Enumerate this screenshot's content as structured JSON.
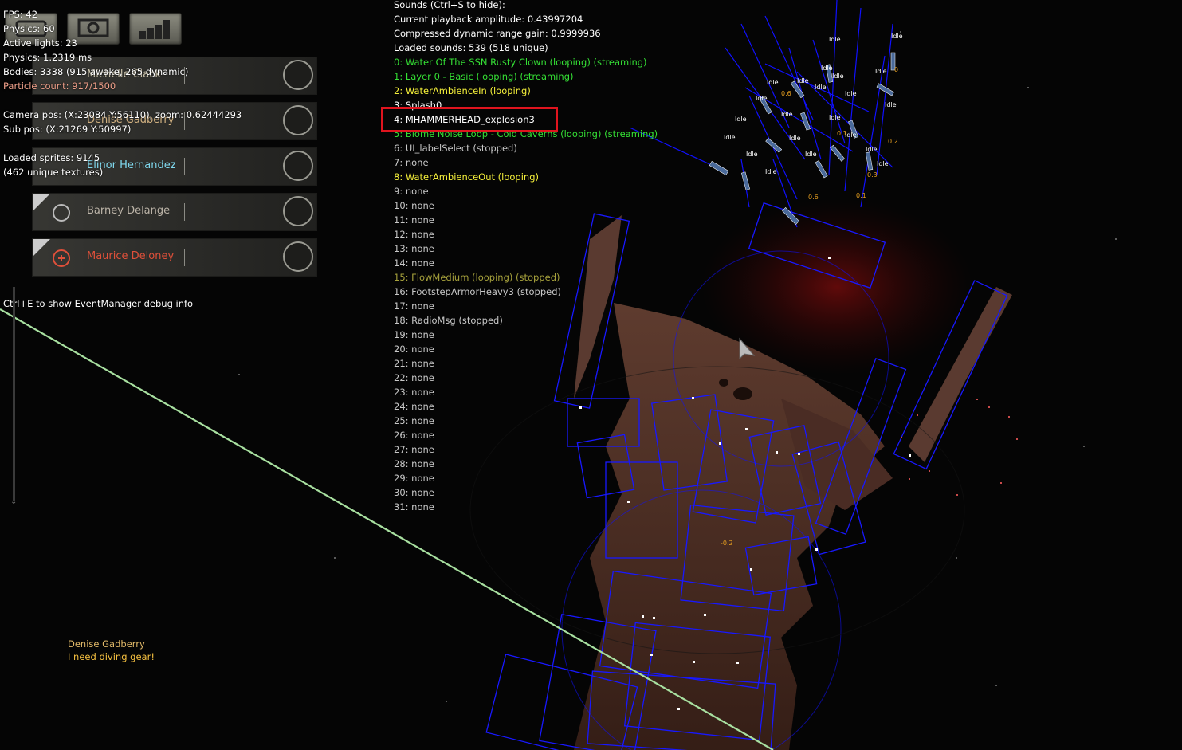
{
  "debug": {
    "fps": "FPS: 42",
    "physics": "Physics: 60",
    "active_lights": "Active lights: 23",
    "physics_time": "Physics: 1.2319 ms",
    "bodies": "Bodies: 3338 (915 awake, 265 dynamic)",
    "particle_count": "Particle count: 917/1500",
    "camera_pos": "Camera pos: (X:23084 Y:56110), zoom: 0.62444293",
    "sub_pos": "Sub pos: (X:21269 Y:50997)",
    "loaded_sprites": "Loaded sprites: 9145",
    "unique_textures": "(462 unique textures)"
  },
  "toolbar": {
    "icons": [
      "crew-icon",
      "command-icon",
      "stats-icon"
    ]
  },
  "crew": [
    {
      "name": "Michelle Clack",
      "color": "#d0c8b0",
      "order_icon": "order-icon"
    },
    {
      "name": "Denise Gadberry",
      "color": "#d0b080",
      "order_icon": "order-icon"
    },
    {
      "name": "Elinor Hernandez",
      "color": "#7fd8ee",
      "order_icon": "order-icon"
    },
    {
      "name": "Barney Delange",
      "color": "#bcb4a8",
      "order_icon": "order-icon"
    },
    {
      "name": "Maurice Deloney",
      "color": "#e0503a",
      "order_icon": "order-icon"
    }
  ],
  "sounds": {
    "header": "Sounds (Ctrl+S to hide):",
    "amplitude": "Current playback amplitude: 0.43997204",
    "gain": "Compressed dynamic range gain: 0.9999936",
    "loaded": "Loaded sounds: 539 (518 unique)",
    "channels": [
      {
        "text": "0: Water Of The SSN Rusty Clown (looping) (streaming)",
        "color": "green"
      },
      {
        "text": "1: Layer 0 - Basic (looping) (streaming)",
        "color": "green"
      },
      {
        "text": "2: WaterAmbienceIn (looping)",
        "color": "yellow"
      },
      {
        "text": "3: Splash0",
        "color": "white"
      },
      {
        "text": "4: MHAMMERHEAD_explosion3",
        "color": "white"
      },
      {
        "text": "5: Biome Noise Loop - Cold Caverns (looping) (streaming)",
        "color": "green"
      },
      {
        "text": "6: UI_labelSelect (stopped)",
        "color": "grey"
      },
      {
        "text": "7: none",
        "color": "grey"
      },
      {
        "text": "8: WaterAmbienceOut (looping)",
        "color": "yellow"
      },
      {
        "text": "9: none",
        "color": "grey"
      },
      {
        "text": "10: none",
        "color": "grey"
      },
      {
        "text": "11: none",
        "color": "grey"
      },
      {
        "text": "12: none",
        "color": "grey"
      },
      {
        "text": "13: none",
        "color": "grey"
      },
      {
        "text": "14: none",
        "color": "grey"
      },
      {
        "text": "15: FlowMedium (looping) (stopped)",
        "color": "olive"
      },
      {
        "text": "16: FootstepArmorHeavy3 (stopped)",
        "color": "grey"
      },
      {
        "text": "17: none",
        "color": "grey"
      },
      {
        "text": "18: RadioMsg (stopped)",
        "color": "grey"
      },
      {
        "text": "19: none",
        "color": "grey"
      },
      {
        "text": "20: none",
        "color": "grey"
      },
      {
        "text": "21: none",
        "color": "grey"
      },
      {
        "text": "22: none",
        "color": "grey"
      },
      {
        "text": "23: none",
        "color": "grey"
      },
      {
        "text": "24: none",
        "color": "grey"
      },
      {
        "text": "25: none",
        "color": "grey"
      },
      {
        "text": "26: none",
        "color": "grey"
      },
      {
        "text": "27: none",
        "color": "grey"
      },
      {
        "text": "28: none",
        "color": "grey"
      },
      {
        "text": "29: none",
        "color": "grey"
      },
      {
        "text": "30: none",
        "color": "grey"
      },
      {
        "text": "31: none",
        "color": "grey"
      }
    ],
    "highlighted_index": 4
  },
  "eventmanager_hint": "Ctrl+E to show EventManager debug info",
  "chat": {
    "speaker": "Denise Gadberry",
    "message": "I need diving gear!"
  },
  "world": {
    "idle_label": "Idle",
    "debug_values": [
      "0",
      "0.6",
      "0.1",
      "0.2",
      "0.3",
      "0.1",
      "0.6",
      "-0.2"
    ],
    "creature_label": "-0.2"
  },
  "colors": {
    "debug_wire": "#1010ff",
    "highlight": "#e0141e",
    "laser": "#a8e0a0"
  }
}
